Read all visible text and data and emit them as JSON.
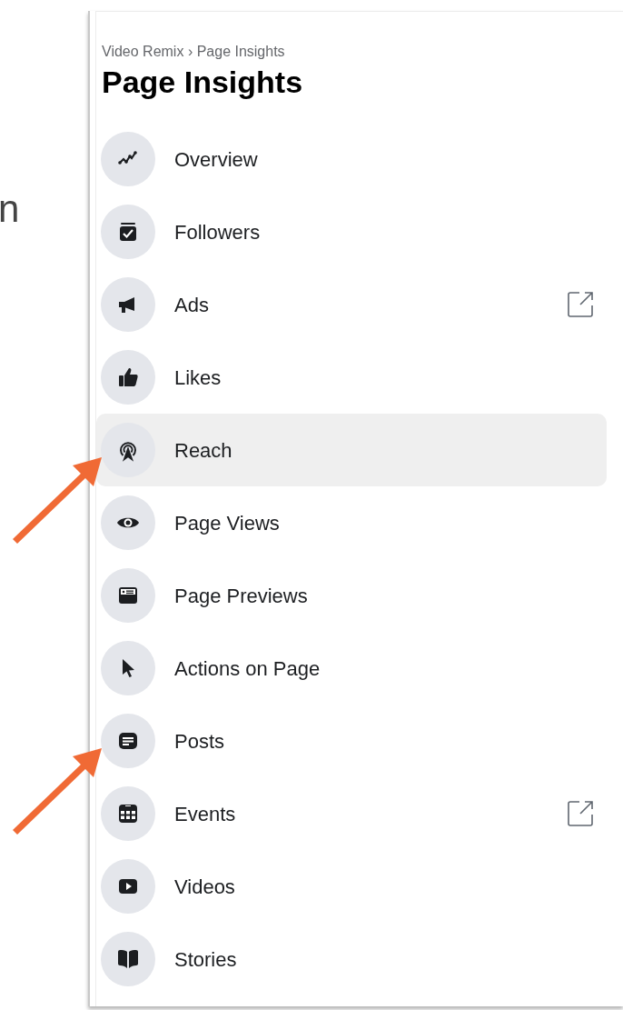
{
  "side_text": "n",
  "breadcrumb": [
    "Video Remix",
    "›",
    "Page Insights"
  ],
  "title": "Page Insights",
  "items": [
    {
      "label": "Overview",
      "selected": false,
      "external": false,
      "annotated": false
    },
    {
      "label": "Followers",
      "selected": false,
      "external": false,
      "annotated": false
    },
    {
      "label": "Ads",
      "selected": false,
      "external": true,
      "annotated": false
    },
    {
      "label": "Likes",
      "selected": false,
      "external": false,
      "annotated": false
    },
    {
      "label": "Reach",
      "selected": true,
      "external": false,
      "annotated": true
    },
    {
      "label": "Page Views",
      "selected": false,
      "external": false,
      "annotated": false
    },
    {
      "label": "Page Previews",
      "selected": false,
      "external": false,
      "annotated": false
    },
    {
      "label": "Actions on Page",
      "selected": false,
      "external": false,
      "annotated": false
    },
    {
      "label": "Posts",
      "selected": false,
      "external": false,
      "annotated": true
    },
    {
      "label": "Events",
      "selected": false,
      "external": true,
      "annotated": false
    },
    {
      "label": "Videos",
      "selected": false,
      "external": false,
      "annotated": false
    },
    {
      "label": "Stories",
      "selected": false,
      "external": false,
      "annotated": false
    }
  ]
}
